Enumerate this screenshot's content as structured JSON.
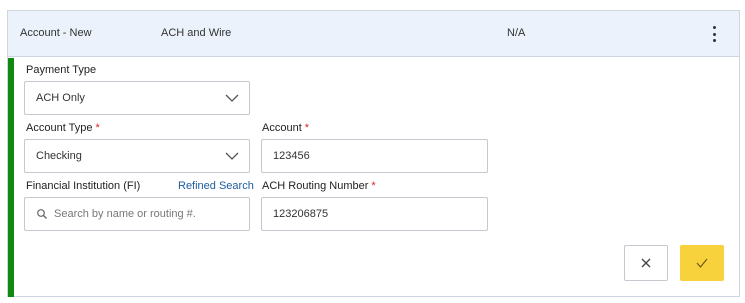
{
  "summary": {
    "name": "Account - New",
    "method": "ACH and Wire",
    "status": "N/A",
    "menu_icon": "kebab-menu-icon"
  },
  "form": {
    "payment_type": {
      "label": "Payment Type",
      "value": "ACH Only"
    },
    "account_type": {
      "label": "Account Type",
      "required": "*",
      "value": "Checking"
    },
    "account": {
      "label": "Account",
      "required": "*",
      "value": "123456"
    },
    "financial_institution": {
      "label": "Financial Institution (FI)",
      "link": "Refined Search",
      "placeholder": "Search by name or routing #."
    },
    "routing": {
      "label": "ACH Routing Number",
      "required": "*",
      "value": "123206875"
    }
  },
  "actions": {
    "cancel_icon": "close-icon",
    "confirm_icon": "checkmark-icon"
  },
  "colors": {
    "accent_bar": "#0f8a0f",
    "confirm": "#f7d23c",
    "required": "#dd2222",
    "link": "#1d5c9e",
    "header_bg": "#ebf2fb"
  }
}
